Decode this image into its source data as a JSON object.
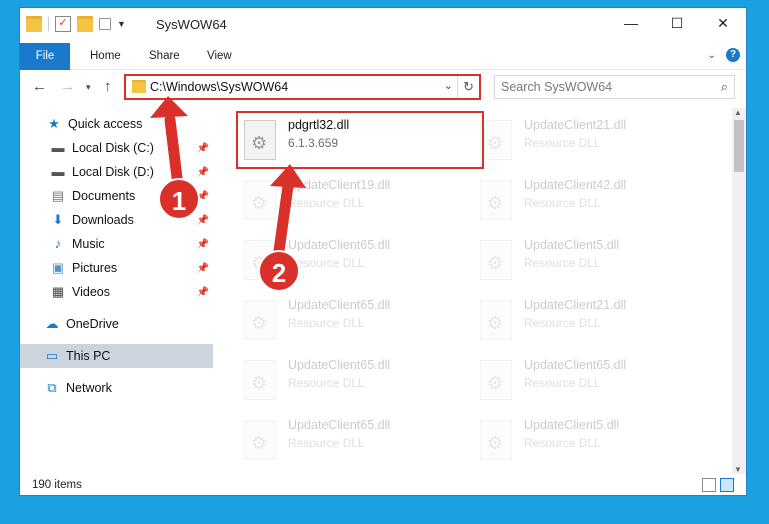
{
  "window": {
    "title": "SysWOW64"
  },
  "ribbon": {
    "tabs": [
      "File",
      "Home",
      "Share",
      "View"
    ],
    "help": "?"
  },
  "address": {
    "path": "C:\\Windows\\SysWOW64",
    "refresh": "↻"
  },
  "search": {
    "placeholder": "Search SysWOW64"
  },
  "sidebar": {
    "items": [
      {
        "label": "Quick access",
        "icon": "star-icon"
      },
      {
        "label": "Local Disk (C:)",
        "icon": "drive-icon"
      },
      {
        "label": "Local Disk (D:)",
        "icon": "drive-icon"
      },
      {
        "label": "Documents",
        "icon": "documents-icon"
      },
      {
        "label": "Downloads",
        "icon": "download-icon"
      },
      {
        "label": "Music",
        "icon": "music-icon"
      },
      {
        "label": "Pictures",
        "icon": "pictures-icon"
      },
      {
        "label": "Videos",
        "icon": "videos-icon"
      },
      {
        "label": "OneDrive",
        "icon": "cloud-icon"
      },
      {
        "label": "This PC",
        "icon": "computer-icon"
      },
      {
        "label": "Network",
        "icon": "network-icon"
      }
    ]
  },
  "files": [
    {
      "name": "pdgrtl32.dll",
      "desc": "6.1.3.659"
    },
    {
      "name": "UpdateClient21.dll",
      "desc": "Resource DLL"
    },
    {
      "name": "UpdateClient19.dll",
      "desc": "Resource DLL"
    },
    {
      "name": "UpdateClient42.dll",
      "desc": "Resource DLL"
    },
    {
      "name": "UpdateClient65.dll",
      "desc": "Resource DLL"
    },
    {
      "name": "UpdateClient5.dll",
      "desc": "Resource DLL"
    },
    {
      "name": "UpdateClient65.dll",
      "desc": "Resource DLL"
    },
    {
      "name": "UpdateClient21.dll",
      "desc": "Resource DLL"
    },
    {
      "name": "UpdateClient65.dll",
      "desc": "Resource DLL"
    },
    {
      "name": "UpdateClient65.dll",
      "desc": "Resource DLL"
    },
    {
      "name": "UpdateClient65.dll",
      "desc": "Resource DLL"
    },
    {
      "name": "UpdateClient5.dll",
      "desc": "Resource DLL"
    }
  ],
  "status": {
    "count": "190 items"
  },
  "annotations": {
    "step1": "1",
    "step2": "2",
    "color": "#d9312a"
  }
}
